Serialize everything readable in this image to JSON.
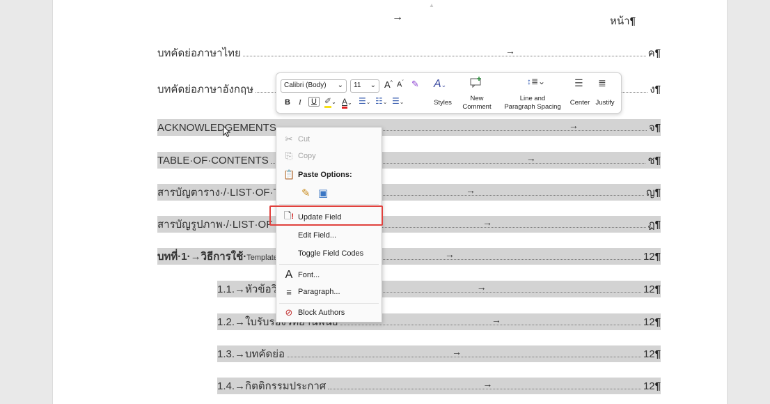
{
  "document": {
    "header_arrow": "→",
    "header_page_label": "หน้า",
    "pilcrow": "¶",
    "toc": [
      {
        "label": "บทคัดย่อภาษาไทย",
        "page": "ค",
        "highlight": false
      },
      {
        "label": "บทคัดย่อภาษาอังกฤษ",
        "page": "ง",
        "highlight": false
      },
      {
        "label": "ACKNOWLEDGEMENTS",
        "page": "จ",
        "highlight": true
      },
      {
        "label": "TABLE·OF·CONTENTS",
        "page": "ช",
        "highlight": true
      },
      {
        "label": "สารบัญตาราง·/·LIST·OF·TABLES",
        "page": "ญ",
        "highlight": true
      },
      {
        "label": "สารบัญรูปภาพ·/·LIST·OF·FIGURES",
        "page": "ฏ",
        "highlight": true
      },
      {
        "label": "บทที่·1·→วิธีการใช้·",
        "label_small": "Template",
        "page": "12",
        "highlight": true
      },
      {
        "label": "1.1.→หัวข้อวิทยานิพนธ์",
        "page": "12",
        "highlight": true
      },
      {
        "label": "1.2.→ใบรับรองวิทยานิพนธ์",
        "page": "12",
        "highlight": true
      },
      {
        "label": "1.3.→บทคัดย่อ",
        "page": "12",
        "highlight": true
      },
      {
        "label": "1.4.→กิตติกรรมประกาศ",
        "page": "12",
        "highlight": true
      }
    ]
  },
  "mini_toolbar": {
    "font_name": "Calibri (Body)",
    "font_size": "11",
    "grow_font": "A^",
    "shrink_font": "A˅",
    "bold": "B",
    "italic": "I",
    "underline": "U",
    "font_color": "A",
    "styles_label": "Styles",
    "new_comment_label_1": "New",
    "new_comment_label_2": "Comment",
    "line_spacing_label_1": "Line and",
    "line_spacing_label_2": "Paragraph Spacing",
    "center_label": "Center",
    "justify_label": "Justify",
    "highlight_color": "#f7e017",
    "font_color_hex": "#e02020"
  },
  "context_menu": {
    "items": [
      {
        "label": "Cut",
        "icon": "scissors-icon",
        "disabled": true
      },
      {
        "label": "Copy",
        "icon": "copy-icon",
        "disabled": true
      },
      {
        "label": "Paste Options:",
        "icon": "paste-icon",
        "disabled": false
      },
      {
        "label": "Update Field",
        "icon": "update-field-icon",
        "disabled": false
      },
      {
        "label": "Edit Field...",
        "icon": "",
        "disabled": false
      },
      {
        "label": "Toggle Field Codes",
        "icon": "",
        "disabled": false
      },
      {
        "label": "Font...",
        "icon": "font-icon",
        "disabled": false
      },
      {
        "label": "Paragraph...",
        "icon": "paragraph-icon",
        "disabled": false
      },
      {
        "label": "Block Authors",
        "icon": "block-authors-icon",
        "disabled": false
      }
    ],
    "highlight_border_color": "#e0413d"
  }
}
